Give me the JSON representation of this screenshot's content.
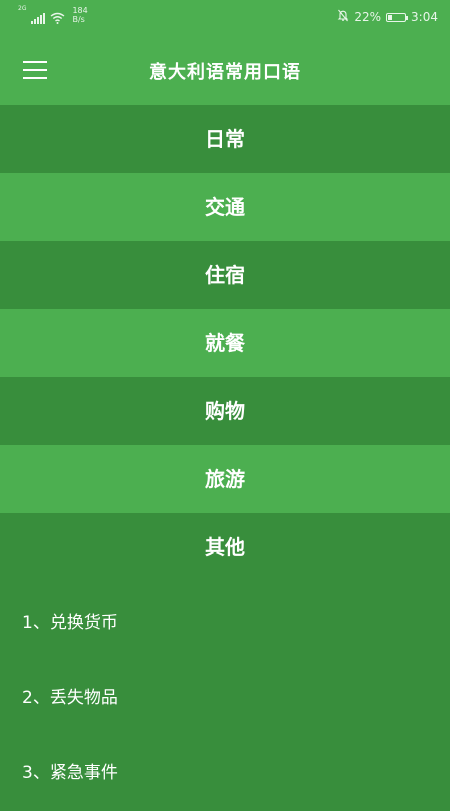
{
  "status_bar": {
    "signal_label": "2G",
    "net_speed_value": "184",
    "net_speed_unit": "B/s",
    "battery_percent": "22%",
    "battery_level": 0.22,
    "time": "3:04",
    "icons": [
      "signal-icon",
      "wifi-icon",
      "mute-bell-icon",
      "battery-icon"
    ]
  },
  "toolbar": {
    "title": "意大利语常用口语",
    "menu_icon": "hamburger-menu-icon"
  },
  "categories": [
    {
      "label": "日常"
    },
    {
      "label": "交通"
    },
    {
      "label": "住宿"
    },
    {
      "label": "就餐"
    },
    {
      "label": "购物"
    },
    {
      "label": "旅游"
    },
    {
      "label": "其他"
    }
  ],
  "expanded_items": [
    {
      "label": "1、兑换货币"
    },
    {
      "label": "2、丢失物品"
    },
    {
      "label": "3、紧急事件"
    }
  ],
  "colors": {
    "primary": "#4caf50",
    "primary_dark": "#388e3c",
    "text": "#ffffff"
  }
}
